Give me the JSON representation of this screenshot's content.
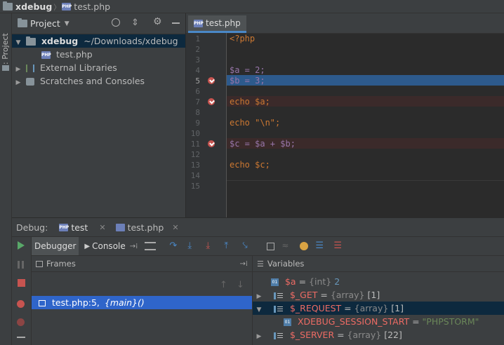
{
  "navbar": {
    "project": "xdebug",
    "sep": "〉",
    "file": "test.php",
    "php_badge": "PHP"
  },
  "leftstrip": {
    "label": "1: Project"
  },
  "project": {
    "title": "Project",
    "tree": [
      {
        "arrow": "▼",
        "name": "xdebug",
        "path": "~/Downloads/xdebug"
      },
      {
        "name": "test.php"
      },
      {
        "arrow": "▶",
        "name": "External Libraries"
      },
      {
        "arrow": "▶",
        "name": "Scratches and Consoles"
      }
    ]
  },
  "editor": {
    "tab": "test.php",
    "lines": [
      {
        "n": "1",
        "code": "<?php"
      },
      {
        "n": "2",
        "code": ""
      },
      {
        "n": "3",
        "code": ""
      },
      {
        "n": "4",
        "code": "$a = 2;"
      },
      {
        "n": "5",
        "code": "$b = 3;"
      },
      {
        "n": "6",
        "code": ""
      },
      {
        "n": "7",
        "code": "echo $a;"
      },
      {
        "n": "8",
        "code": ""
      },
      {
        "n": "9",
        "code": "echo \"\\n\";"
      },
      {
        "n": "10",
        "code": ""
      },
      {
        "n": "11",
        "code": "$c = $a + $b;"
      },
      {
        "n": "12",
        "code": ""
      },
      {
        "n": "13",
        "code": "echo $c;"
      },
      {
        "n": "14",
        "code": ""
      },
      {
        "n": "15",
        "code": ""
      }
    ]
  },
  "debug": {
    "label": "Debug:",
    "tabs": [
      "test",
      "test.php"
    ],
    "subtabs": {
      "debugger": "Debugger",
      "console": "Console"
    },
    "frames_title": "Frames",
    "frame": {
      "location": "test.php:5,",
      "func": "{main}()"
    },
    "variables_title": "Variables",
    "variables": [
      {
        "name": "$a",
        "eq": " = ",
        "type": "{int}",
        "value": "2"
      },
      {
        "name": "$_GET",
        "eq": " = ",
        "type": "{array}",
        "value": "[1]"
      },
      {
        "name": "$_REQUEST",
        "eq": " = ",
        "type": "{array}",
        "value": "[1]"
      },
      {
        "name": "XDEBUG_SESSION_START",
        "eq": " = ",
        "value": "\"PHPSTORM\""
      },
      {
        "name": "$_SERVER",
        "eq": " = ",
        "type": "{array}",
        "value": "[22]"
      }
    ]
  }
}
